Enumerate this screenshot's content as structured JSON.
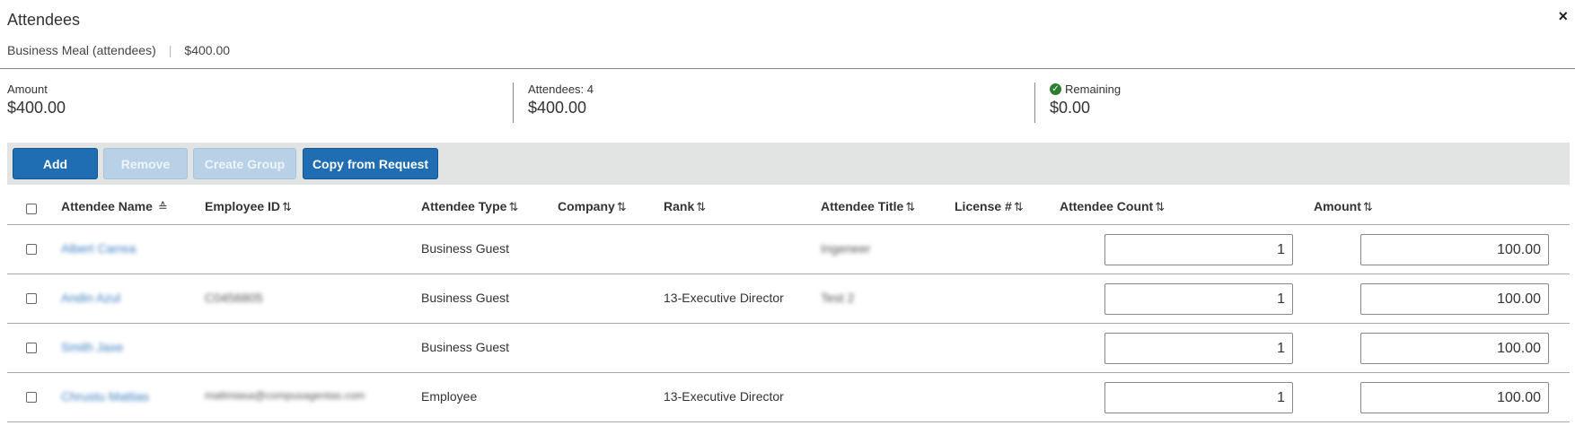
{
  "dialog": {
    "title": "Attendees",
    "expense_type": "Business Meal (attendees)",
    "expense_amount": "$400.00",
    "close_symbol": "×"
  },
  "summary": {
    "amount_label": "Amount",
    "amount_value": "$400.00",
    "attendees_label": "Attendees: 4",
    "attendees_value": "$400.00",
    "remaining_label": "Remaining",
    "remaining_value": "$0.00",
    "remaining_status_color": "#2e7d32"
  },
  "toolbar": {
    "add_label": "Add",
    "remove_label": "Remove",
    "create_group_label": "Create Group",
    "copy_label": "Copy from Request"
  },
  "table": {
    "headers": {
      "name": "Attendee Name",
      "employee_id": "Employee ID",
      "type": "Attendee Type",
      "company": "Company",
      "rank": "Rank",
      "title": "Attendee Title",
      "license": "License #",
      "count": "Attendee Count",
      "amount": "Amount"
    },
    "sort_asc_glyph": "≙",
    "sort_glyph": "⇅",
    "rows": [
      {
        "name": "Albert Carrea",
        "employee_id": "",
        "type": "Business Guest",
        "company": "",
        "rank": "",
        "title": "Ingeneer",
        "license": "",
        "count": "1",
        "amount": "100.00"
      },
      {
        "name": "Andin Azul",
        "employee_id": "C0456805",
        "type": "Business Guest",
        "company": "",
        "rank": "13-Executive Director",
        "title": "Test 2",
        "license": "",
        "count": "1",
        "amount": "100.00"
      },
      {
        "name": "Smith Jaxe",
        "employee_id": "",
        "type": "Business Guest",
        "company": "",
        "rank": "",
        "title": "",
        "license": "",
        "count": "1",
        "amount": "100.00"
      },
      {
        "name": "Chrustu Mattias",
        "employee_id": "mattmiasa@compusagentas.com",
        "type": "Employee",
        "company": "",
        "rank": "13-Executive Director",
        "title": "",
        "license": "",
        "count": "1",
        "amount": "100.00"
      }
    ]
  }
}
